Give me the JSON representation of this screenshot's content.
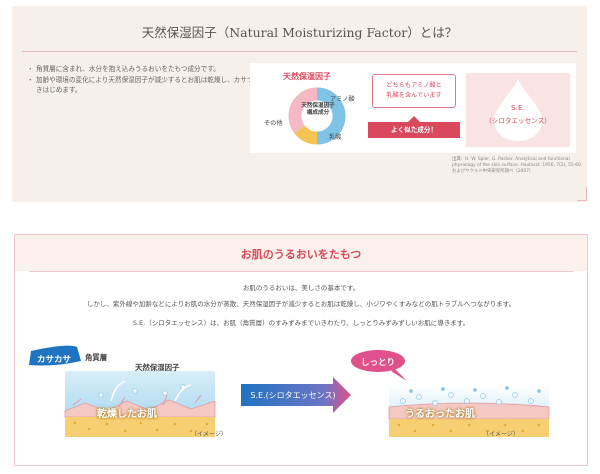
{
  "section1": {
    "title": "天然保湿因子（Natural Moisturizing Factor）とは？",
    "bullets": [
      "角質層に含まれ、水分を抱え込みうるおいをたもつ成分です。",
      "加齢や環境の変化により天然保湿因子が減少するとお肌は乾燥し、カサつきはじめます。"
    ],
    "nmf_label": "天然保湿因子",
    "donut_center": "天然保湿因子\n構成成分",
    "donut_labels": {
      "amino": "アミノ酸",
      "other": "その他",
      "lactic": "乳酸"
    },
    "note_text": "どちらもアミノ酸と\n乳酸を含んでいます",
    "note_ribbon": "よく似た成分！",
    "se_name": "S.E.",
    "se_sub": "（シロタエッセンス）",
    "source": "出典：H. W. Spier, G. Pasher. Analytical and functional physiology of the skin surface. Hautarzt. 1956, 7(2), 55-60.\nおよびヤクルト中央研究所調べ（2007）",
    "colors": {
      "pink": "#d9485c",
      "amino": "#7fc3e6",
      "other": "#f4b9c3",
      "lactic": "#f6c453"
    }
  },
  "section2": {
    "title": "お肌のうるおいをたもつ",
    "lines": [
      "お肌のうるおいは、美しさの基本です。",
      "しかし、紫外線や加齢などによりお肌の水分が蒸散、天然保湿因子が減少するとお肌は乾燥し、小ジワやくすみなどの肌トラブルへつながります。",
      "S.E.（シロタエッセンス）は、お肌（角質層）のすみずみまでいきわたり、しっとりみずみずしいお肌に導きます。"
    ],
    "tag_dry": "カサカサ",
    "label_horn": "角質層",
    "label_nmf": "天然保湿因子",
    "label_dry_skin": "乾燥したお肌",
    "label_image_1": "（イメージ）",
    "arrow_text": "S.E.(シロタエッセンス)",
    "tag_moist": "しっとり",
    "label_moist_skin": "うるおったお肌",
    "label_image_2": "（イメージ）"
  }
}
